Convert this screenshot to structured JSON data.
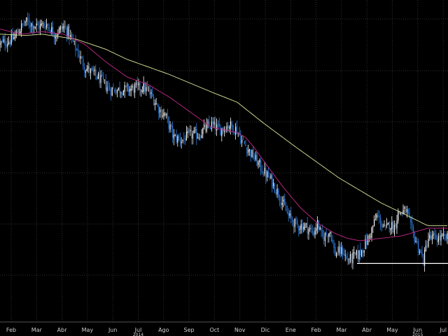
{
  "chart_data": {
    "type": "candlestick",
    "grid": true,
    "legend": "none",
    "x_tick_labels": [
      "Feb",
      "Mar",
      "Abr",
      "May",
      "Jun",
      "Jul",
      "Ago",
      "Sep",
      "Oct",
      "Nov",
      "Dic",
      "Ene",
      "Feb",
      "Mar",
      "Abr",
      "May",
      "Jun",
      "Jul"
    ],
    "year_labels": [
      "2014",
      "2015"
    ],
    "ylim": [
      0,
      100
    ],
    "price_anchors": [
      [
        0,
        88
      ],
      [
        3,
        90
      ],
      [
        6,
        97
      ],
      [
        9,
        95
      ],
      [
        11,
        96
      ],
      [
        13,
        92
      ],
      [
        15,
        95
      ],
      [
        16,
        93
      ],
      [
        18,
        86
      ],
      [
        20,
        79
      ],
      [
        23,
        75
      ],
      [
        26,
        70
      ],
      [
        30,
        70
      ],
      [
        34,
        71
      ],
      [
        36,
        67
      ],
      [
        38,
        61
      ],
      [
        39,
        60
      ],
      [
        41,
        51
      ],
      [
        43,
        50
      ],
      [
        45,
        52
      ],
      [
        47,
        52
      ],
      [
        48,
        54
      ],
      [
        50,
        56
      ],
      [
        52,
        54
      ],
      [
        54,
        56
      ],
      [
        55,
        55
      ],
      [
        56,
        54
      ],
      [
        57,
        50
      ],
      [
        60,
        43
      ],
      [
        62,
        38
      ],
      [
        64,
        34
      ],
      [
        66,
        28
      ],
      [
        68,
        20
      ],
      [
        70,
        16
      ],
      [
        72,
        16
      ],
      [
        74,
        13
      ],
      [
        75,
        17
      ],
      [
        76,
        11
      ],
      [
        78,
        14
      ],
      [
        79,
        5
      ],
      [
        81,
        6
      ],
      [
        82,
        2
      ],
      [
        84,
        4
      ],
      [
        85,
        5
      ],
      [
        87,
        11
      ],
      [
        89,
        20
      ],
      [
        91,
        14
      ],
      [
        92,
        17
      ],
      [
        93,
        15
      ],
      [
        94,
        21
      ],
      [
        96,
        22
      ],
      [
        97,
        15
      ],
      [
        98,
        11
      ],
      [
        100,
        2
      ],
      [
        101,
        11
      ]
    ],
    "ma_short": [
      [
        0,
        94
      ],
      [
        5,
        92
      ],
      [
        10,
        93
      ],
      [
        15,
        92
      ],
      [
        20,
        88
      ],
      [
        25,
        81
      ],
      [
        30,
        75
      ],
      [
        35,
        72
      ],
      [
        40,
        67
      ],
      [
        45,
        61
      ],
      [
        50,
        55
      ],
      [
        53,
        54
      ],
      [
        56,
        53
      ],
      [
        58,
        51
      ],
      [
        60,
        47
      ],
      [
        63,
        40
      ],
      [
        67,
        31
      ],
      [
        71,
        23
      ],
      [
        75,
        17
      ],
      [
        79,
        13
      ],
      [
        82,
        11
      ],
      [
        85,
        10
      ],
      [
        90,
        11
      ],
      [
        95,
        12
      ],
      [
        101,
        15
      ]
    ],
    "ma_long": [
      [
        0,
        92
      ],
      [
        6,
        91.5
      ],
      [
        10,
        92
      ],
      [
        14,
        91
      ],
      [
        18,
        90
      ],
      [
        25,
        86
      ],
      [
        30,
        82
      ],
      [
        40,
        76
      ],
      [
        50,
        69
      ],
      [
        56,
        65
      ],
      [
        62,
        57
      ],
      [
        70,
        47
      ],
      [
        80,
        35
      ],
      [
        90,
        25
      ],
      [
        95,
        21
      ],
      [
        101,
        16
      ]
    ],
    "support_level": 1,
    "colors": {
      "background": "#000000",
      "grid": "#2f2f2f",
      "candle_up": "#ffffff",
      "candle_down": "#2d7de0",
      "ma_short": "#b3267f",
      "ma_long": "#c7d38a",
      "support": "#ffffff"
    }
  }
}
